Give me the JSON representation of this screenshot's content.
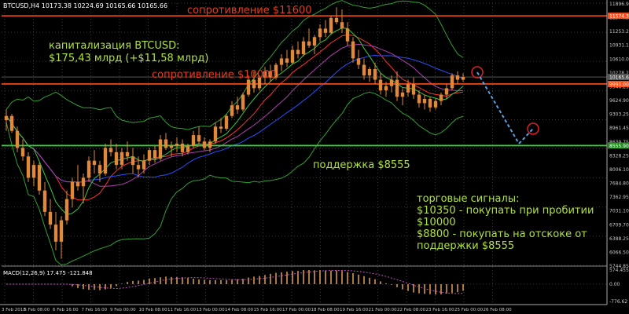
{
  "header": {
    "symbol_line": "BTCUSD,H4  10173.38 10224.69 10165.66 10165.66"
  },
  "annotations": {
    "resistance_top": "сопротивление $11600",
    "resistance_mid": "сопротивление $10000",
    "support": "поддержка $8555",
    "cap_line1": "капитализация BTCUSD:",
    "cap_line2": "$175,43 млрд (+$11,58 млрд)",
    "signals_title": "торговые сигналы:",
    "signals_1": "$10350 - покупать при пробитии",
    "signals_2": "$10000",
    "signals_3": "$8800 - покупать на отскоке от",
    "signals_4": "поддержки $8555"
  },
  "macd": {
    "label": "MACD(12,26,9) 17.475 -121.848",
    "ticks": [
      "574.455",
      "0.00",
      "-776.62"
    ]
  },
  "colors": {
    "background": "#000000",
    "grid": "#3a3a3a",
    "axis_text": "#c8c8c8",
    "candle_body": "#e0893a",
    "resistance": "#ff4d1a",
    "support": "#33cc33",
    "annotation_green": "#b0e040",
    "annotation_red": "#e63c1e",
    "forecast": "#5aa0e6",
    "bollinger": "#32a032",
    "ma_red": "#ff3030",
    "ma_blue": "#2850ff",
    "ma_purple": "#b040b0",
    "ma_green": "#3cc83c",
    "macd_hist": "#e0a050",
    "macd_signal": "#c050c0"
  },
  "chart_data": {
    "type": "candlestick",
    "title": "BTCUSD,H4",
    "y_ticks": [
      "11896.90",
      "11574.30",
      "11253.20",
      "10931.10",
      "10610.00",
      "10278.20",
      "9946.25",
      "9624.90",
      "9303.25",
      "8961.45",
      "8639.75",
      "8328.25",
      "8006.10",
      "7684.80",
      "7362.95",
      "7031.10",
      "6709.70",
      "6388.25",
      "6066.50",
      "5744.85"
    ],
    "y_price_labels": {
      "current": "10165.66",
      "resistance": "11574.30",
      "support": "8555.90",
      "marker": "9990.00"
    },
    "x_ticks": [
      "3 Feb 2018",
      "5 Feb 08:00",
      "6 Feb 16:00",
      "7 Feb 16:00",
      "9 Feb 00:00",
      "10 Feb 08:00",
      "11 Feb 16:00",
      "13 Feb 00:00",
      "14 Feb 08:00",
      "15 Feb 16:00",
      "17 Feb 00:00",
      "18 Feb 08:00",
      "19 Feb 16:00",
      "21 Feb 00:00",
      "22 Feb 08:00",
      "23 Feb 16:00",
      "25 Feb 00:00",
      "26 Feb 08:00"
    ],
    "levels": {
      "resistance_top": 11600,
      "resistance_mid": 10000,
      "support": 8555
    },
    "candles": [
      [
        9150,
        9400,
        8900,
        9250
      ],
      [
        9250,
        9300,
        8850,
        8900
      ],
      [
        8900,
        9000,
        8400,
        8500
      ],
      [
        8500,
        8700,
        8200,
        8300
      ],
      [
        8300,
        8400,
        7700,
        7800
      ],
      [
        7800,
        8200,
        7600,
        8100
      ],
      [
        8100,
        8150,
        7400,
        7500
      ],
      [
        7500,
        7700,
        6900,
        7000
      ],
      [
        7000,
        7300,
        6600,
        6700
      ],
      [
        6700,
        7000,
        6100,
        6300
      ],
      [
        6300,
        6900,
        5900,
        6800
      ],
      [
        6800,
        7500,
        6700,
        7300
      ],
      [
        7300,
        7800,
        7100,
        7700
      ],
      [
        7700,
        8100,
        7500,
        7600
      ],
      [
        7600,
        7900,
        7200,
        7800
      ],
      [
        7800,
        8300,
        7700,
        8200
      ],
      [
        8200,
        8450,
        7900,
        8100
      ],
      [
        8100,
        8200,
        7700,
        7900
      ],
      [
        7900,
        8600,
        7850,
        8500
      ],
      [
        8500,
        8700,
        8300,
        8400
      ],
      [
        8400,
        8600,
        8000,
        8100
      ],
      [
        8100,
        8500,
        8000,
        8400
      ],
      [
        8400,
        8650,
        8200,
        8300
      ],
      [
        8300,
        8500,
        7900,
        8100
      ],
      [
        8100,
        8300,
        7800,
        8000
      ],
      [
        8000,
        8350,
        7900,
        8200
      ],
      [
        8200,
        8500,
        8100,
        8450
      ],
      [
        8450,
        8550,
        8150,
        8250
      ],
      [
        8250,
        8800,
        8200,
        8700
      ],
      [
        8700,
        8850,
        8450,
        8500
      ],
      [
        8500,
        8650,
        8300,
        8550
      ],
      [
        8550,
        8750,
        8400,
        8600
      ],
      [
        8600,
        8700,
        8300,
        8400
      ],
      [
        8400,
        8600,
        8350,
        8550
      ],
      [
        8550,
        8900,
        8500,
        8800
      ],
      [
        8800,
        9000,
        8600,
        8650
      ],
      [
        8650,
        8750,
        8450,
        8500
      ],
      [
        8500,
        8700,
        8400,
        8650
      ],
      [
        8650,
        9100,
        8600,
        9000
      ],
      [
        9000,
        9200,
        8850,
        8950
      ],
      [
        8950,
        9300,
        8900,
        9250
      ],
      [
        9250,
        9600,
        9200,
        9500
      ],
      [
        9500,
        9700,
        9300,
        9400
      ],
      [
        9400,
        9800,
        9350,
        9750
      ],
      [
        9750,
        10200,
        9700,
        10100
      ],
      [
        10100,
        10300,
        9800,
        9900
      ],
      [
        9900,
        10200,
        9850,
        10150
      ],
      [
        10150,
        10400,
        10000,
        10300
      ],
      [
        10300,
        10450,
        10050,
        10150
      ],
      [
        10150,
        10500,
        10100,
        10450
      ],
      [
        10450,
        10700,
        10300,
        10600
      ],
      [
        10600,
        10800,
        10400,
        10500
      ],
      [
        10500,
        10900,
        10450,
        10800
      ],
      [
        10800,
        11000,
        10600,
        10700
      ],
      [
        10700,
        11100,
        10650,
        11000
      ],
      [
        11000,
        11300,
        10850,
        10900
      ],
      [
        10900,
        11150,
        10700,
        11100
      ],
      [
        11100,
        11400,
        11000,
        11300
      ],
      [
        11300,
        11500,
        11100,
        11200
      ],
      [
        11200,
        11600,
        11150,
        11550
      ],
      [
        11550,
        11800,
        11400,
        11450
      ],
      [
        11450,
        11750,
        11200,
        11300
      ],
      [
        11300,
        11450,
        10900,
        11000
      ],
      [
        11000,
        11100,
        10500,
        10600
      ],
      [
        10600,
        10800,
        10350,
        10450
      ],
      [
        10450,
        10600,
        10100,
        10200
      ],
      [
        10200,
        10400,
        10050,
        10350
      ],
      [
        10350,
        10500,
        10000,
        10100
      ],
      [
        10100,
        10250,
        9750,
        9850
      ],
      [
        9850,
        10050,
        9700,
        9950
      ],
      [
        9950,
        10200,
        9800,
        10100
      ],
      [
        10100,
        10300,
        9600,
        9700
      ],
      [
        9700,
        9900,
        9500,
        9800
      ],
      [
        9800,
        10100,
        9700,
        10000
      ],
      [
        10000,
        10150,
        9650,
        9750
      ],
      [
        9750,
        9850,
        9450,
        9550
      ],
      [
        9550,
        9750,
        9400,
        9650
      ],
      [
        9650,
        9700,
        9350,
        9450
      ],
      [
        9450,
        9650,
        9400,
        9600
      ],
      [
        9600,
        9800,
        9500,
        9750
      ],
      [
        9750,
        10000,
        9650,
        9900
      ],
      [
        9900,
        10250,
        9850,
        10200
      ],
      [
        10200,
        10300,
        10000,
        10100
      ],
      [
        10100,
        10250,
        10050,
        10165
      ]
    ],
    "forecast_path": [
      [
        10165,
        0
      ],
      [
        8600,
        1
      ],
      [
        8950,
        2
      ]
    ]
  }
}
